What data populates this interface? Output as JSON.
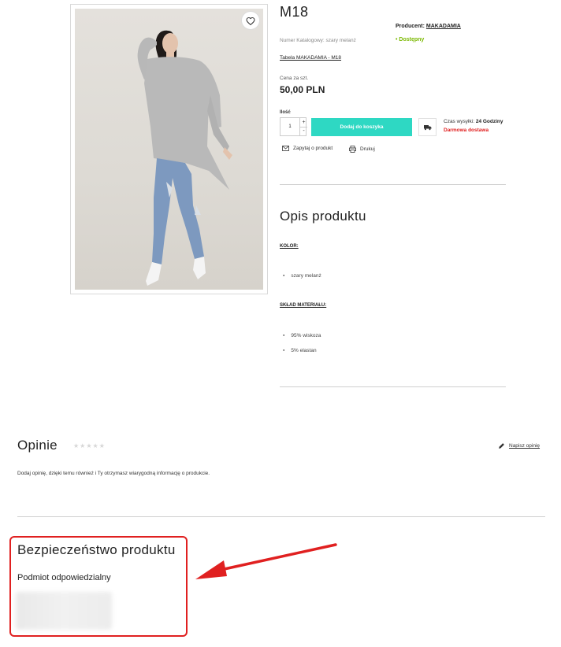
{
  "product": {
    "title": "M18",
    "producer_label": "Producent:",
    "producer_value": "MAKADAMIA",
    "catalog_number": "Numer Katalogowy: szary melanż",
    "availability": "• Dostępny",
    "size_table_link": "Tabela MAKADAMIA - M18",
    "price_label": "Cena za szt.",
    "price": "50,00 PLN",
    "quantity_label": "Ilość",
    "quantity_value": "1",
    "qty_plus": "+",
    "qty_minus": "-",
    "add_to_cart": "Dodaj do koszyka",
    "shipping_time_label": "Czas wysyłki:",
    "shipping_time_value": "24 Godziny",
    "free_shipping": "Darmowa dostawa",
    "ask_label": "Zapytaj o produkt",
    "print_label": "Drukuj"
  },
  "description": {
    "title": "Opis produktu",
    "color_heading": "KOLOR:",
    "color_items": [
      "szary melanż"
    ],
    "material_heading": "SKŁAD MATERIAŁU:",
    "material_items": [
      "95% wiskoza",
      "5% elastan"
    ]
  },
  "reviews": {
    "title": "Opinie",
    "stars": "★★★★★",
    "rating": 0,
    "write_review": "Napisz opinię",
    "empty_text": "Dodaj opinię, dzięki temu również i Ty otrzymasz wiarygodną informację o produkcie."
  },
  "safety": {
    "title": "Bezpieczeństwo produktu",
    "responsible_entity": "Podmiot odpowiedzialny"
  },
  "colors": {
    "accent": "#2ed8c3",
    "available": "#7ab800",
    "free_shipping": "#e02020",
    "annotation": "#e02020"
  },
  "icons": {
    "wishlist": "heart-icon",
    "shipping": "truck-icon",
    "ask": "envelope-icon",
    "print": "printer-icon",
    "write": "pencil-icon",
    "annotation": "arrow-icon"
  }
}
